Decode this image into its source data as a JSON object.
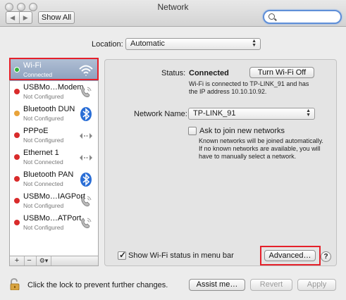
{
  "window": {
    "title": "Network"
  },
  "toolbar": {
    "show_all_label": "Show All",
    "search_placeholder": ""
  },
  "location": {
    "label": "Location:",
    "value": "Automatic"
  },
  "sidebar": {
    "services": [
      {
        "name": "Wi-Fi",
        "status": "Connected",
        "dot_color": "#33b33a",
        "icon": "wifi-icon",
        "selected": true
      },
      {
        "name": "USBMo…Modem",
        "status": "Not Configured",
        "dot_color": "#d92b2b",
        "icon": "phone-icon"
      },
      {
        "name": "Bluetooth DUN",
        "status": "Not Configured",
        "dot_color": "#e8a33a",
        "icon": "bluetooth-icon"
      },
      {
        "name": "PPPoE",
        "status": "Not Configured",
        "dot_color": "#d92b2b",
        "icon": "ethernet-arrows-icon"
      },
      {
        "name": "Ethernet 1",
        "status": "Not Connected",
        "dot_color": "#d92b2b",
        "icon": "ethernet-arrows-icon"
      },
      {
        "name": "Bluetooth PAN",
        "status": "Not Connected",
        "dot_color": "#d92b2b",
        "icon": "bluetooth-icon"
      },
      {
        "name": "USBMo…IAGPort",
        "status": "Not Configured",
        "dot_color": "#d92b2b",
        "icon": "phone-icon"
      },
      {
        "name": "USBMo…ATPort",
        "status": "Not Configured",
        "dot_color": "#d92b2b",
        "icon": "phone-icon"
      }
    ],
    "add_label": "+",
    "remove_label": "−",
    "gear_label": "⚙▾"
  },
  "detail": {
    "status_label": "Status:",
    "status_value": "Connected",
    "turn_off_label": "Turn Wi-Fi Off",
    "status_desc_line1": "Wi-Fi is connected to TP-LINK_91 and has",
    "status_desc_line2": "the IP address 10.10.10.92.",
    "network_name_label": "Network Name:",
    "network_name_value": "TP-LINK_91",
    "ask_join_label": "Ask to join new networks",
    "ask_join_checked": false,
    "ask_desc_line1": "Known networks will be joined automatically.",
    "ask_desc_line2": "If no known networks are available, you will",
    "ask_desc_line3": "have to manually select a network.",
    "show_status_label": "Show Wi-Fi status in menu bar",
    "show_status_checked": true,
    "advanced_label": "Advanced…",
    "help_label": "?"
  },
  "footer": {
    "lock_text": "Click the lock to prevent further changes.",
    "assist_label": "Assist me…",
    "revert_label": "Revert",
    "apply_label": "Apply"
  },
  "colors": {
    "highlight_red": "#e5202a",
    "selection": "#8b9fbd"
  }
}
